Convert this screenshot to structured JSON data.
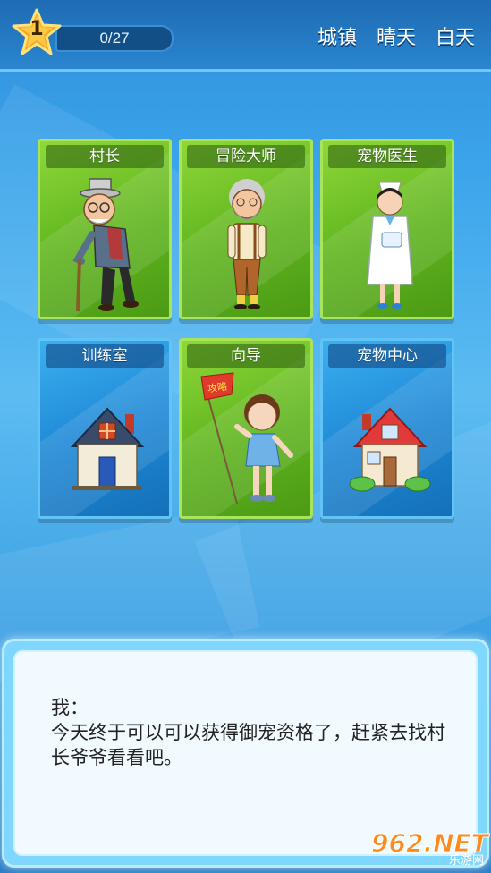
{
  "header": {
    "level": "1",
    "progress_text": "0/27",
    "progress_fraction": 0,
    "location": "城镇",
    "weather": "晴天",
    "time_of_day": "白天"
  },
  "cards": [
    {
      "title": "村长",
      "icon": "old-man-with-cane-icon",
      "color": "green"
    },
    {
      "title": "冒险大师",
      "icon": "bearded-adventurer-icon",
      "color": "green"
    },
    {
      "title": "宠物医生",
      "icon": "nurse-icon",
      "color": "green"
    },
    {
      "title": "训练室",
      "icon": "house-icon",
      "color": "blue"
    },
    {
      "title": "向导",
      "icon": "guide-girl-with-flag-icon",
      "color": "green",
      "flag_text": "攻略"
    },
    {
      "title": "宠物中心",
      "icon": "red-roof-house-icon",
      "color": "blue"
    }
  ],
  "dialog": {
    "speaker": "我：",
    "text": "今天终于可以可以获得御宠资格了，赶紧去找村长爷爷看看吧。"
  },
  "watermark": {
    "main": "962.NET",
    "sub": "乐游网"
  },
  "colors": {
    "green_card": "#5fb41e",
    "blue_card": "#1e86d4",
    "topbar": "#1e6cb3",
    "dialog_border": "#7fd6ff"
  }
}
